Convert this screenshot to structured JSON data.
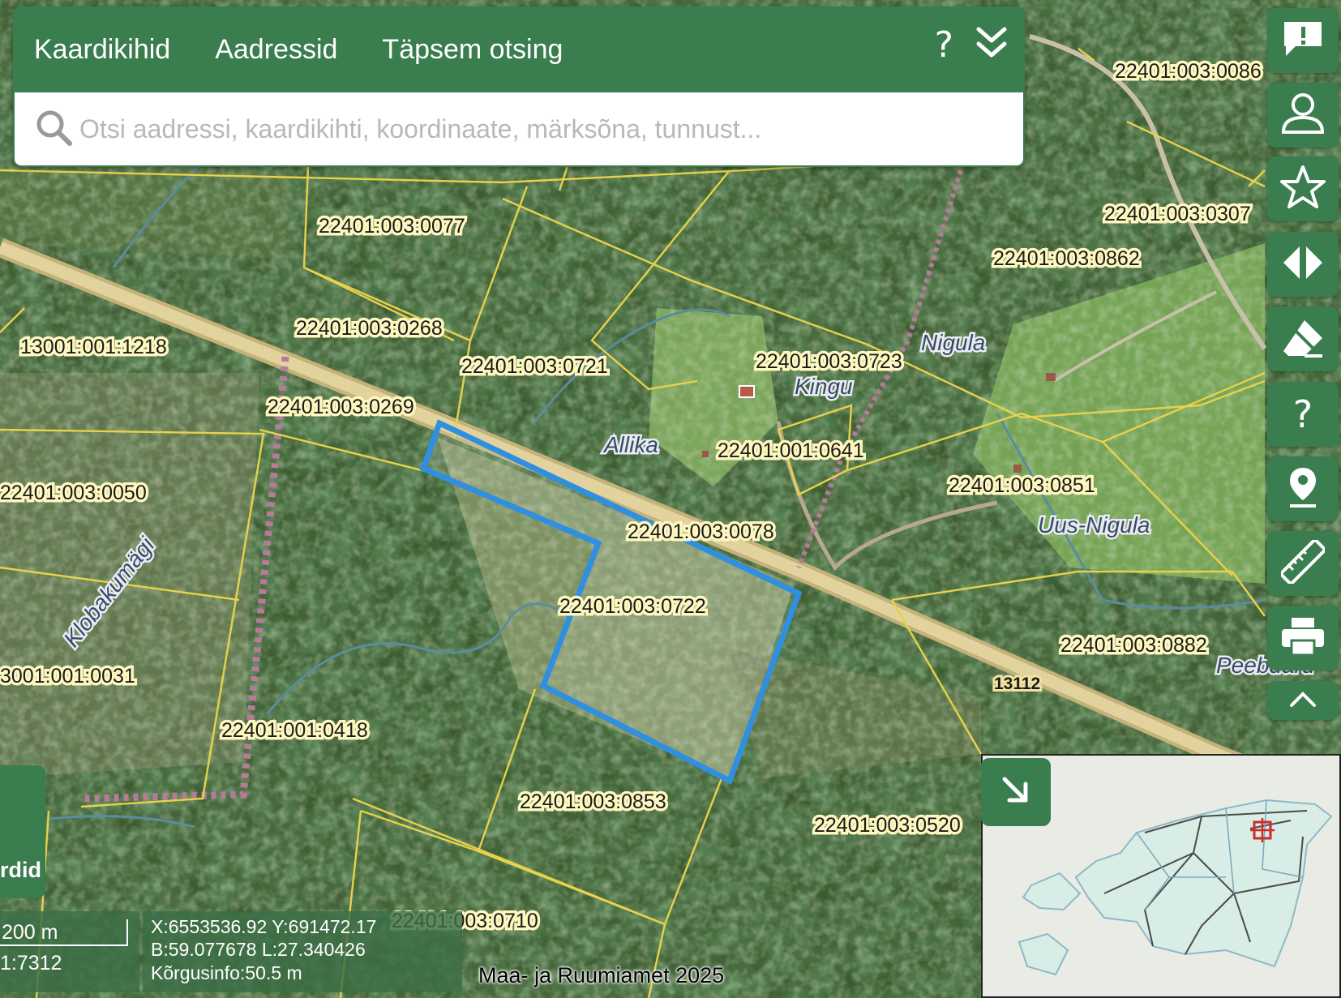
{
  "header": {
    "tabs": [
      "Kaardikihid",
      "Aadressid",
      "Täpsem otsing"
    ],
    "help_label": "?",
    "collapse_icon": "double-chevron-down-icon"
  },
  "search": {
    "placeholder": "Otsi aadressi, kaardikihti, koordinaate, märksõna, tunnust...",
    "value": ""
  },
  "toolbar": {
    "icons": [
      "feedback-icon",
      "user-icon",
      "star-icon",
      "compare-icon",
      "eraser-icon",
      "help-icon",
      "location-icon",
      "ruler-icon",
      "print-icon",
      "chevron-up-icon"
    ],
    "help_label": "?"
  },
  "parcels": [
    "22401:003:0086",
    "22401:003:0307",
    "22401:003:0862",
    "22401:003:0077",
    "22401:003:0268",
    "13001:001:1218",
    "22401:003:0721",
    "22401:003:0723",
    "22401:003:0269",
    "22401:001:0641",
    "22401:003:0851",
    "22401:003:0050",
    "22401:003:0078",
    "22401:003:0722",
    "22401:003:0882",
    "3001:001:0031",
    "22401:001:0418",
    "22401:003:0853",
    "22401:003:0520",
    "22401:003:0710"
  ],
  "place_names": [
    "Nigula",
    "Kingu",
    "Allika",
    "Uus-Nigula",
    "Klobakumägi",
    "Peebuaru"
  ],
  "road_number": "13112",
  "legend_panel": {
    "label": "rdid"
  },
  "scale": {
    "distance": "200 m",
    "ratio": "1:7312"
  },
  "coordinates": {
    "xy": "X:6553536.92 Y:691472.17",
    "bl": "B:59.077678 L:27.340426",
    "height": "Kõrgusinfo:50.5 m"
  },
  "attribution": "Maa- ja Ruumiamet 2025",
  "overview": {
    "toggle_icon": "arrow-down-right-icon",
    "marker_icon": "location-target-icon"
  },
  "colors": {
    "panel_green": "#3a7d4f",
    "parcel_line": "#e8d24a",
    "selection": "#2f8fe0",
    "road": "#d8c88a",
    "boundary": "#b77a9a"
  }
}
